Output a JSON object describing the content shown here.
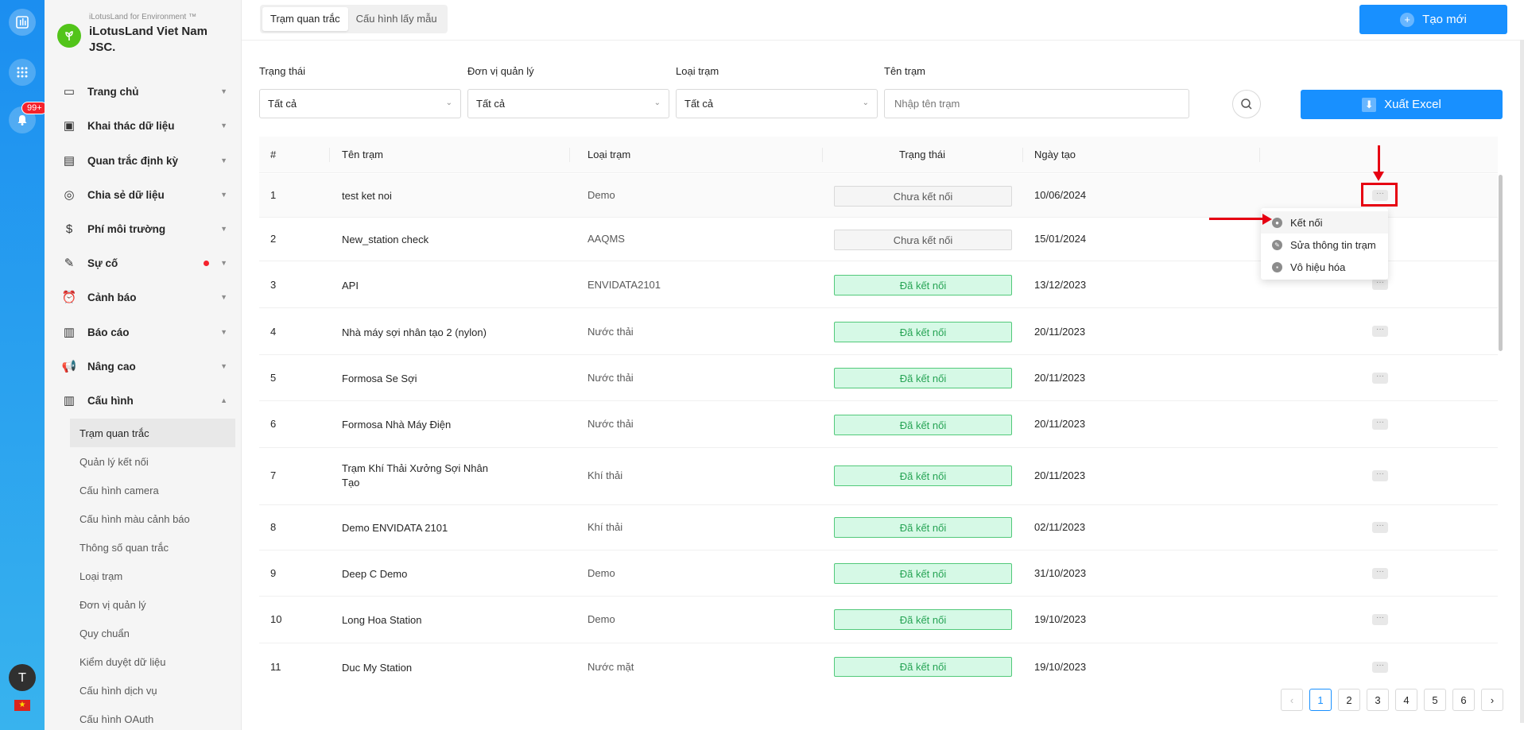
{
  "rail": {
    "badge": "99+",
    "avatar": "T",
    "flag": "★"
  },
  "org": {
    "tag": "iLotusLand for Environment ™",
    "name": "iLotusLand Viet Nam JSC."
  },
  "menu": [
    {
      "label": "Trang chủ",
      "icon": "▭"
    },
    {
      "label": "Khai thác dữ liệu",
      "icon": "▣"
    },
    {
      "label": "Quan trắc định kỳ",
      "icon": "▤"
    },
    {
      "label": "Chia sẻ dữ liệu",
      "icon": "◎"
    },
    {
      "label": "Phí môi trường",
      "icon": "$"
    },
    {
      "label": "Sự cố",
      "icon": "✎"
    },
    {
      "label": "Cảnh báo",
      "icon": "⏰"
    },
    {
      "label": "Báo cáo",
      "icon": "▥"
    },
    {
      "label": "Nâng cao",
      "icon": "📢"
    },
    {
      "label": "Cấu hình",
      "icon": "▥"
    }
  ],
  "submenu": [
    "Trạm quan trắc",
    "Quản lý kết nối",
    "Cấu hình camera",
    "Cấu hình màu cảnh báo",
    "Thông số quan trắc",
    "Loại trạm",
    "Đơn vị quản lý",
    "Quy chuẩn",
    "Kiểm duyệt dữ liệu",
    "Cấu hình dịch vụ",
    "Cấu hình OAuth"
  ],
  "tabs": [
    "Trạm quan trắc",
    "Cấu hình lấy mẫu"
  ],
  "buttons": {
    "new": "Tạo mới",
    "excel": "Xuất Excel"
  },
  "filters": {
    "status": {
      "label": "Trạng thái",
      "value": "Tất cả"
    },
    "unit": {
      "label": "Đơn vị quản lý",
      "value": "Tất cả"
    },
    "type": {
      "label": "Loại trạm",
      "value": "Tất cả"
    },
    "name": {
      "label": "Tên trạm",
      "placeholder": "Nhập tên trạm"
    }
  },
  "columns": [
    "#",
    "Tên trạm",
    "Loại trạm",
    "Trạng thái",
    "Ngày tạo"
  ],
  "rows": [
    {
      "n": "1",
      "name": "test ket noi",
      "type": "Demo",
      "status": "Chưa kết nối",
      "date": "10/06/2024"
    },
    {
      "n": "2",
      "name": "New_station check",
      "type": "AAQMS",
      "status": "Chưa kết nối",
      "date": "15/01/2024"
    },
    {
      "n": "3",
      "name": "API",
      "type": "ENVIDATA2101",
      "status": "Đã kết nối",
      "date": "13/12/2023"
    },
    {
      "n": "4",
      "name": "Nhà máy sợi nhân tạo 2 (nylon)",
      "type": "Nước thải",
      "status": "Đã kết nối",
      "date": "20/11/2023"
    },
    {
      "n": "5",
      "name": "Formosa Se Sợi",
      "type": "Nước thải",
      "status": "Đã kết nối",
      "date": "20/11/2023"
    },
    {
      "n": "6",
      "name": "Formosa Nhà Máy Điện",
      "type": "Nước thải",
      "status": "Đã kết nối",
      "date": "20/11/2023"
    },
    {
      "n": "7",
      "name": "Trạm Khí Thải Xưởng Sợi Nhân Tạo",
      "type": "Khí thải",
      "status": "Đã kết nối",
      "date": "20/11/2023"
    },
    {
      "n": "8",
      "name": "Demo ENVIDATA 2101",
      "type": "Khí thải",
      "status": "Đã kết nối",
      "date": "02/11/2023"
    },
    {
      "n": "9",
      "name": "Deep C Demo",
      "type": "Demo",
      "status": "Đã kết nối",
      "date": "31/10/2023"
    },
    {
      "n": "10",
      "name": "Long Hoa Station",
      "type": "Demo",
      "status": "Đã kết nối",
      "date": "19/10/2023"
    },
    {
      "n": "11",
      "name": "Duc My Station",
      "type": "Nước mặt",
      "status": "Đã kết nối",
      "date": "19/10/2023"
    }
  ],
  "dropdown": [
    "Kết nối",
    "Sửa thông tin trạm",
    "Vô hiệu hóa"
  ],
  "pagination": {
    "prev": "‹",
    "pages": [
      "1",
      "2",
      "3",
      "4",
      "5",
      "6"
    ],
    "next": "›",
    "current": "1"
  },
  "colors": {
    "primary": "#1890ff",
    "connected_bg": "#d6f9e6",
    "annotation": "#e60012"
  }
}
